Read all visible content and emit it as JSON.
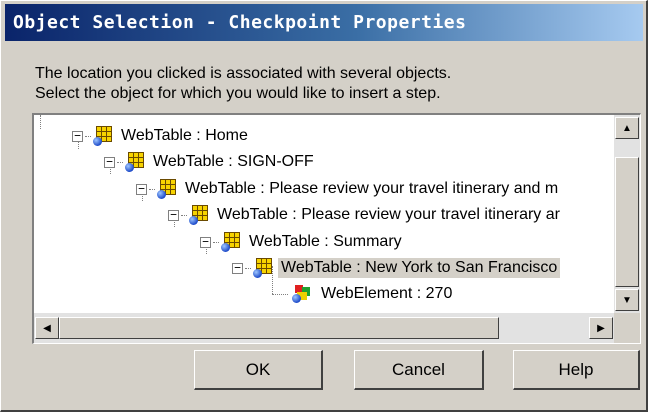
{
  "window": {
    "title": "Object Selection - Checkpoint Properties"
  },
  "message": {
    "line1": "The location you clicked is associated with several objects.",
    "line2": "Select the object for which you would like to insert a step."
  },
  "tree": {
    "nodes": [
      {
        "label": "WebTable : Home",
        "icon": "webtable-icon",
        "expanded": true
      },
      {
        "label": "WebTable : SIGN-OFF",
        "icon": "webtable-icon",
        "expanded": true
      },
      {
        "label": "WebTable : Please review your travel itinerary and m",
        "icon": "webtable-icon",
        "expanded": true
      },
      {
        "label": "WebTable : Please review your travel itinerary ar",
        "icon": "webtable-icon",
        "expanded": true
      },
      {
        "label": "WebTable : Summary",
        "icon": "webtable-icon",
        "expanded": true
      },
      {
        "label": "WebTable : New York to San Francisco",
        "icon": "webtable-icon",
        "expanded": true,
        "selected": true
      },
      {
        "label": "WebElement : 270",
        "icon": "webelement-icon"
      }
    ]
  },
  "scrollbars": {
    "up_arrow": "▲",
    "down_arrow": "▼",
    "left_arrow": "◀",
    "right_arrow": "▶"
  },
  "buttons": {
    "ok": "OK",
    "cancel": "Cancel",
    "help": "Help"
  },
  "colors": {
    "title_bar_start": "#0a246a",
    "title_bar_end": "#a6caf0",
    "dialog_background": "#d4d0c8"
  }
}
